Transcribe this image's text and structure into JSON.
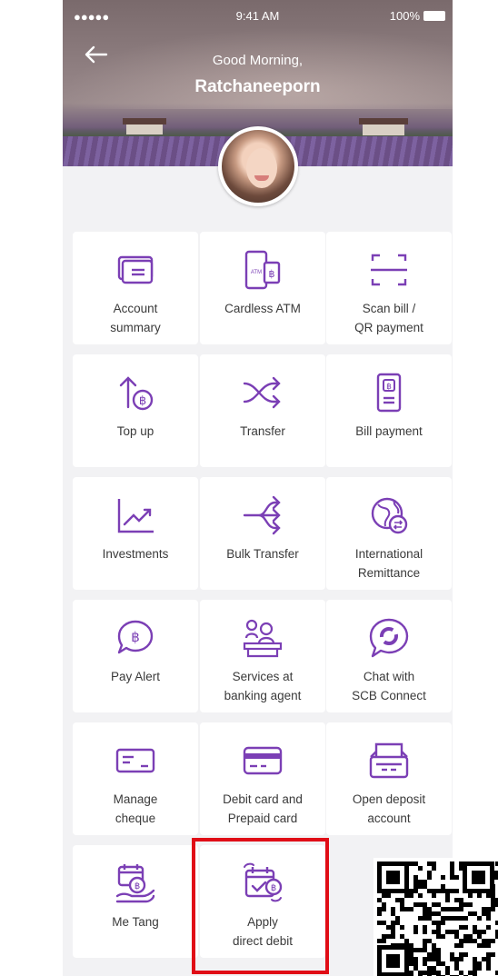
{
  "status_bar": {
    "signal": "●●●●● ",
    "time": "9:41 AM",
    "battery": "100%"
  },
  "header": {
    "greeting": "Good Morning,",
    "username": "Ratchaneeporn"
  },
  "colors": {
    "accent": "#7b3fb5",
    "highlight": "#e00d16",
    "tile_bg": "#ffffff",
    "page_bg": "#f2f2f4"
  },
  "tiles": [
    {
      "label": "Account summary",
      "icon": "account-summary-icon"
    },
    {
      "label": "Cardless ATM",
      "icon": "cardless-atm-icon"
    },
    {
      "label": "Scan bill / QR payment",
      "icon": "scan-qr-icon"
    },
    {
      "label": "Top up",
      "icon": "top-up-icon"
    },
    {
      "label": "Transfer",
      "icon": "transfer-icon"
    },
    {
      "label": "Bill payment",
      "icon": "bill-payment-icon"
    },
    {
      "label": "Investments",
      "icon": "investments-icon"
    },
    {
      "label": "Bulk Transfer",
      "icon": "bulk-transfer-icon"
    },
    {
      "label": "International Remittance",
      "icon": "international-remittance-icon"
    },
    {
      "label": "Pay Alert",
      "icon": "pay-alert-icon"
    },
    {
      "label": "Services at banking agent",
      "icon": "banking-agent-icon"
    },
    {
      "label": "Chat with SCB Connect",
      "icon": "chat-icon"
    },
    {
      "label": "Manage cheque",
      "icon": "cheque-icon"
    },
    {
      "label": "Debit card and Prepaid card",
      "icon": "debit-card-icon"
    },
    {
      "label": "Open deposit account",
      "icon": "deposit-account-icon"
    },
    {
      "label": "Me Tang",
      "icon": "me-tang-icon"
    },
    {
      "label": "Apply direct debit",
      "icon": "direct-debit-icon"
    }
  ],
  "tile_lines": [
    [
      "Account",
      "summary"
    ],
    [
      "Cardless ATM"
    ],
    [
      "Scan bill /",
      "QR payment"
    ],
    [
      "Top up"
    ],
    [
      "Transfer"
    ],
    [
      "Bill payment"
    ],
    [
      "Investments"
    ],
    [
      "Bulk Transfer"
    ],
    [
      "International",
      "Remittance"
    ],
    [
      "Pay Alert"
    ],
    [
      "Services at",
      "banking agent"
    ],
    [
      "Chat with",
      "SCB Connect"
    ],
    [
      "Manage",
      "cheque"
    ],
    [
      "Debit card and",
      "Prepaid card"
    ],
    [
      "Open deposit",
      "account"
    ],
    [
      "Me Tang"
    ],
    [
      "Apply",
      "direct debit"
    ]
  ],
  "icon_text": {
    "atm": "ATM",
    "baht": "฿"
  }
}
